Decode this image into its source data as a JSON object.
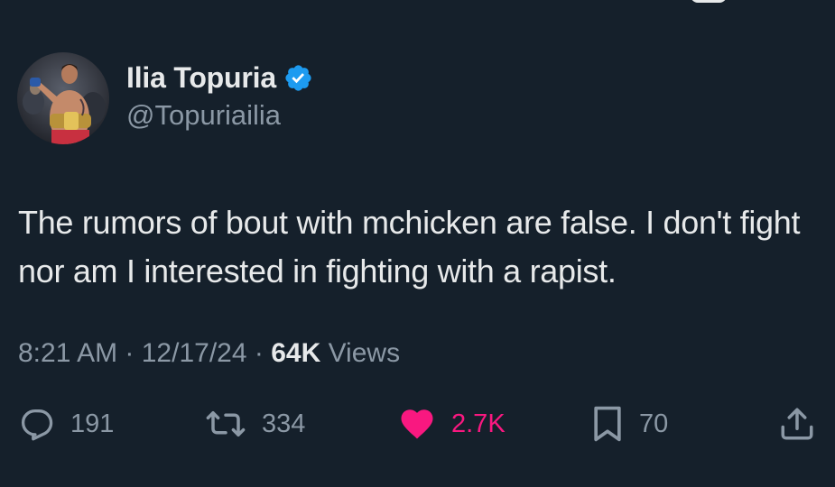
{
  "author": {
    "display_name": "Ilia Topuria",
    "handle": "@Topuriailia",
    "verified": true,
    "verified_color": "#1d9bf0",
    "avatar_icon": "fighter-avatar"
  },
  "tweet": {
    "text": "The rumors of bout with mchicken are false. I don't fight nor am I interested in fighting with a rapist."
  },
  "meta": {
    "time": "8:21 AM",
    "separator1": " · ",
    "date": "12/17/24",
    "separator2": " · ",
    "views_count": "64K",
    "views_label": " Views"
  },
  "actions": {
    "reply": {
      "icon": "reply-icon",
      "count": "191"
    },
    "retweet": {
      "icon": "retweet-icon",
      "count": "334"
    },
    "like": {
      "icon": "heart-icon",
      "count": "2.7K",
      "liked": true,
      "color": "#f91880"
    },
    "bookmark": {
      "icon": "bookmark-icon",
      "count": "70"
    },
    "share": {
      "icon": "share-icon"
    }
  },
  "colors": {
    "background": "#15202b",
    "primary_text": "#e7e9ea",
    "secondary_text": "#8b98a5"
  }
}
